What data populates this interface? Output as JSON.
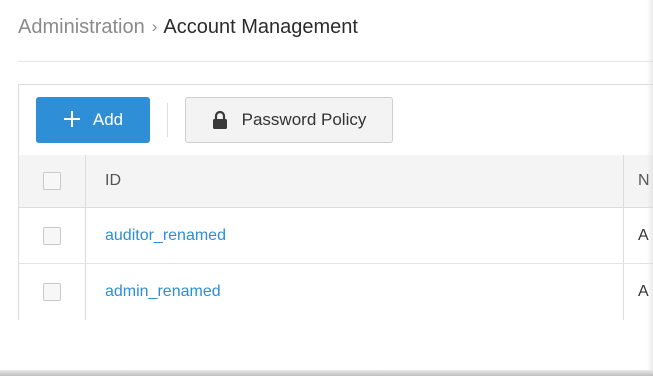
{
  "breadcrumb": {
    "parent": "Administration",
    "separator": "›",
    "current": "Account Management"
  },
  "toolbar": {
    "add_label": "Add",
    "add_icon": "plus-icon",
    "password_policy_label": "Password Policy",
    "password_policy_icon": "lock-icon"
  },
  "table": {
    "headers": {
      "id": "ID",
      "name": "N"
    },
    "rows": [
      {
        "id": "auditor_renamed",
        "name": "A"
      },
      {
        "id": "admin_renamed",
        "name": "A"
      }
    ]
  },
  "colors": {
    "accent": "#2f8fd6",
    "link": "#2b8fd0",
    "header_bg": "#f4f4f4"
  }
}
